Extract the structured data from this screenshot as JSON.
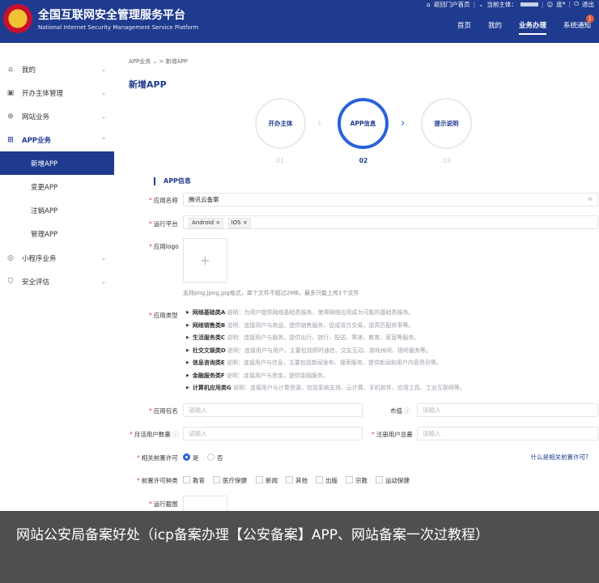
{
  "header": {
    "title_cn": "全国互联网安全管理服务平台",
    "title_en": "National Internet Security Management Service Platform",
    "top_links": {
      "back_portal": "返回门户首页",
      "current_subject": "当前主体：",
      "user": "庞*",
      "logout": "退出"
    },
    "nav": [
      "首页",
      "我的",
      "业务办理",
      "系统通知"
    ],
    "active_nav": "业务办理",
    "notification_count": "1"
  },
  "sidebar": {
    "items": [
      {
        "label": "我的",
        "icon": "home-icon"
      },
      {
        "label": "开办主体管理",
        "icon": "briefcase-icon"
      },
      {
        "label": "网站业务",
        "icon": "globe-icon"
      },
      {
        "label": "APP业务",
        "icon": "grid-icon"
      }
    ],
    "app_sub": [
      "新增APP",
      "变更APP",
      "注销APP",
      "管理APP"
    ],
    "active_sub": "新增APP",
    "bottom_items": [
      {
        "label": "小程序业务",
        "icon": "compass-icon"
      },
      {
        "label": "安全评估",
        "icon": "shield-icon"
      }
    ]
  },
  "breadcrumb": {
    "parent": "APP业务",
    "current": "新增APP"
  },
  "page_title": "新增APP",
  "steps": [
    {
      "label": "开办主体",
      "num": "01"
    },
    {
      "label": "APP信息",
      "num": "02"
    },
    {
      "label": "提示说明",
      "num": "03"
    }
  ],
  "current_step": "2",
  "section_title": "APP信息",
  "form": {
    "app_name": {
      "label": "应用名称",
      "value": "腾讯云备案"
    },
    "platform": {
      "label": "运行平台",
      "tags": [
        "Android",
        "IOS"
      ]
    },
    "logo": {
      "label": "应用logo",
      "hint": "支持png,jpeg,jpg格式，单个文件不超过2MB，最多只能上传1个文件"
    },
    "category": {
      "label": "应用类型",
      "items": [
        {
          "name": "网络基础类A",
          "desc": "说明：为用户提供网络基础类服务，使得网络应用成为可能的基础类服务。"
        },
        {
          "name": "网络销售类B",
          "desc": "说明：连接用户与商品，提供销售服务，促成双方交易，提高匹配效率等。"
        },
        {
          "name": "生活服务类C",
          "desc": "说明：连接用户与服务，提供出行、旅行、配送、寄递、教育、家庭等服务。"
        },
        {
          "name": "社交文娱类D",
          "desc": "说明：连接用户与用户，主要包括即时通信、交友互动、游戏休闲、视听服务等。"
        },
        {
          "name": "信息咨询类E",
          "desc": "说明：连接用户与信息，主要包括新闻发布、搜索服务、提供新闻和用户内容资讯等。"
        },
        {
          "name": "金融服务类F",
          "desc": "说明：连接用户与资金，提供金融服务。"
        },
        {
          "name": "计算机应用类G",
          "desc": "说明：连接用户与计算资源，包括系统支持、云计算、手机软件、应用工具、工业互联网等。"
        }
      ]
    },
    "package": {
      "label": "应用包名",
      "placeholder": "请输入"
    },
    "market_value": {
      "label": "市值",
      "placeholder": "请输入"
    },
    "mau": {
      "label": "月活用户数量",
      "placeholder": "请输入"
    },
    "registered": {
      "label": "注册用户总量",
      "placeholder": "请输入"
    },
    "pre_permit": {
      "label": "相关前置许可",
      "yes": "是",
      "no": "否",
      "selected": "是",
      "help_link": "什么是相关前置许可?"
    },
    "permit_types": {
      "label": "前置许可种类",
      "options": [
        "教育",
        "医疗保健",
        "新闻",
        "其他",
        "出版",
        "宗教",
        "运动保健"
      ]
    },
    "screenshot": {
      "label": "运行截图"
    }
  },
  "caption": "网站公安局备案好处（icp备案办理【公安备案】APP、网站备案一次过教程）"
}
